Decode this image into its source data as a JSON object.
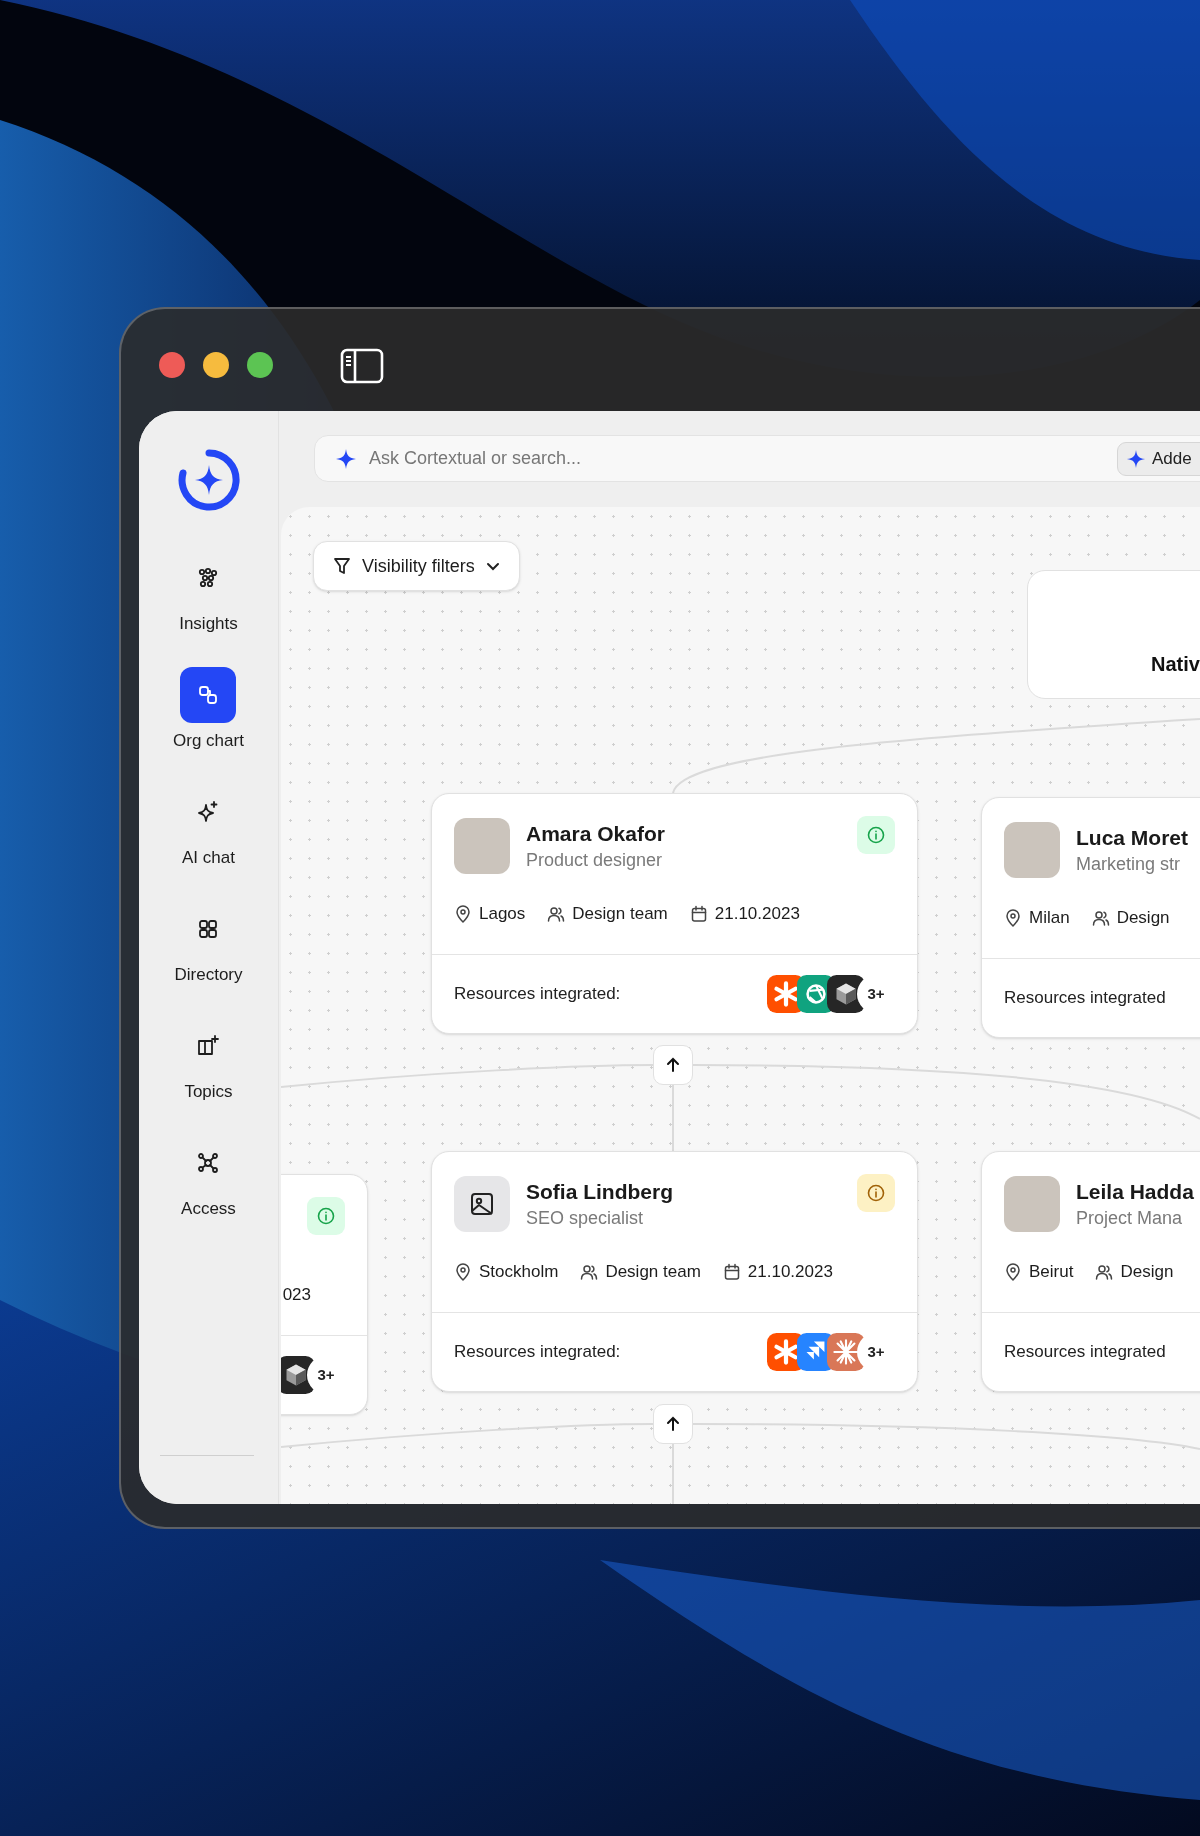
{
  "search": {
    "placeholder": "Ask Cortextual or search...",
    "chip": "Adde"
  },
  "sidebar": {
    "items": [
      {
        "label": "Insights",
        "selected": false
      },
      {
        "label": "Org chart",
        "selected": true
      },
      {
        "label": "AI chat",
        "selected": false
      },
      {
        "label": "Directory",
        "selected": false
      },
      {
        "label": "Topics",
        "selected": false
      },
      {
        "label": "Access",
        "selected": false
      }
    ]
  },
  "canvas": {
    "filter_button": "Visibility filters",
    "top_node": {
      "label": "Nativ"
    },
    "cards": [
      {
        "name": "Amara Okafor",
        "role": "Product designer",
        "avatar": {
          "kind": "photo"
        },
        "color": "#16a34a",
        "location": "Lagos",
        "team": "Design team",
        "date": "21.10.2023",
        "resources_label": "Resources integrated:",
        "resources": [
          {
            "kind": "asterisk",
            "color": "#ff4f00"
          },
          {
            "kind": "knot",
            "color": "#10a37f"
          },
          {
            "kind": "cube",
            "color": "#262626"
          }
        ],
        "more": "3+"
      },
      {
        "name": "Luca Moret",
        "role": "Marketing str",
        "avatar": {
          "kind": "photo"
        },
        "location": "Milan",
        "team": "Design",
        "resources_label": "Resources integrated"
      },
      {
        "color": "#16a34a",
        "date": "023",
        "resources": [
          {
            "kind": "cube",
            "color": "#262626"
          }
        ],
        "more": "3+"
      },
      {
        "name": "Sofia Lindberg",
        "role": "SEO specialist",
        "avatar": {
          "kind": "placeholder"
        },
        "color": "#a16207",
        "location": "Stockholm",
        "team": "Design team",
        "date": "21.10.2023",
        "resources_label": "Resources integrated:",
        "resources": [
          {
            "kind": "asterisk",
            "color": "#ff4f00"
          },
          {
            "kind": "chevrons",
            "color": "#2684ff"
          },
          {
            "kind": "burst",
            "color": "#d97757"
          }
        ],
        "more": "3+"
      },
      {
        "name": "Leila Hadda",
        "role": "Project Mana",
        "avatar": {
          "kind": "photo"
        },
        "location": "Beirut",
        "team": "Design",
        "resources_label": "Resources integrated"
      }
    ]
  }
}
